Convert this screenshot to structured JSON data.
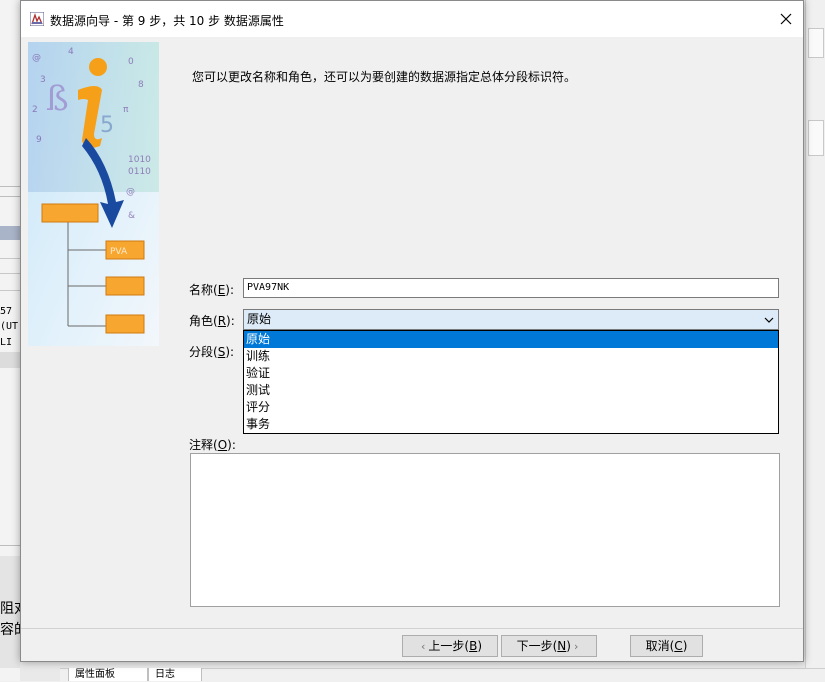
{
  "window": {
    "title": "数据源向导 - 第 9 步，共 10 步 数据源属性",
    "close_label": "✕"
  },
  "intro_text": "您可以更改名称和角色，还可以为要创建的数据源指定总体分段标识符。",
  "fields": {
    "name_label": "名称(",
    "name_key": "E",
    "name_label_end": "):",
    "name_value": "PVA97NK",
    "role_label": "角色(",
    "role_key": "R",
    "role_label_end": "):",
    "role_value": "原始",
    "segment_label": "分段(",
    "segment_key": "S",
    "segment_label_end": "):",
    "notes_label": "注释(",
    "notes_key": "O",
    "notes_label_end": "):"
  },
  "role_options": [
    "原始",
    "训练",
    "验证",
    "测试",
    "评分",
    "事务"
  ],
  "buttons": {
    "back": "上一步(",
    "back_key": "B",
    "back_end": ")",
    "next": "下一步(",
    "next_key": "N",
    "next_end": ")",
    "cancel": "取消(",
    "cancel_key": "C",
    "cancel_end": ")"
  },
  "left_image": {
    "box_label": "PVA"
  },
  "background": {
    "left_texts": [
      "57",
      "(UT",
      "LI"
    ],
    "bottom_left_texts": [
      "阻对",
      "容的"
    ],
    "bottom_tabs": [
      "属性面板",
      "日志"
    ]
  },
  "colors": {
    "selection": "#0078d7",
    "select_bg": "#ddeaf7",
    "orange_box": "#f7a730"
  }
}
